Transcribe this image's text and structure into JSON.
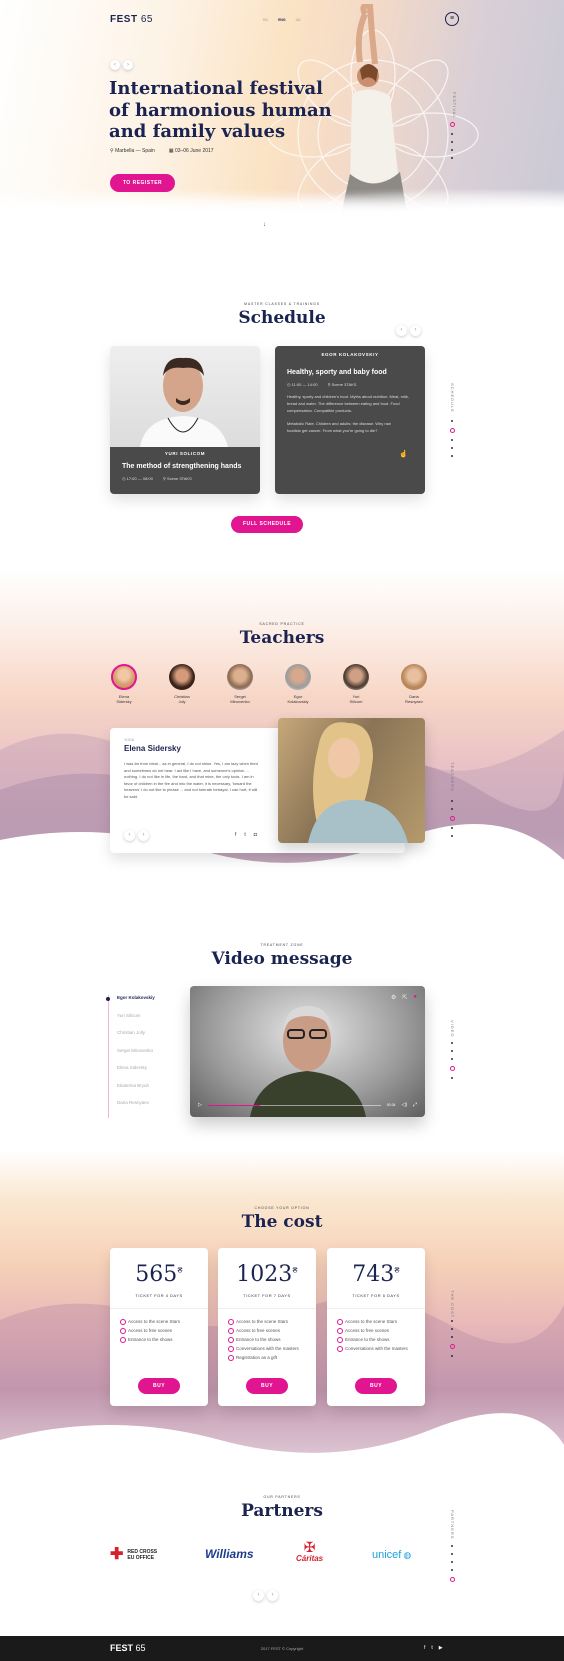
{
  "brand": {
    "name": "FEST",
    "num": "65"
  },
  "lang": [
    "RU",
    "ENG",
    "UA"
  ],
  "hero": {
    "title": [
      "International festival",
      "of harmonious human",
      "and family values"
    ],
    "location": "Marbella — Spain",
    "dates": "03–06 June 2017",
    "cta": "TO REGISTER",
    "side": "FESTIVAL"
  },
  "schedule": {
    "kicker": "MASTER CLASSES & TRAININGS",
    "title": "Schedule",
    "side": "SCHEDULE",
    "cta": "FULL SCHEDULE",
    "cards": [
      {
        "name": "YURI SOLICOM",
        "title": "The method of strengthening hands",
        "time": "17:00 — 08:00",
        "place": "Scene 3TAKS"
      },
      {
        "name": "EGOR KOLAKOVSKIY",
        "title": "Healthy, sporty and baby food",
        "time": "11:00 — 14:00",
        "place": "Scene 3TAKS",
        "text": "Healthy, sporty and children's food. Myths about nutrition. Meat, milk, bread and water. The difference between eating and food. Food compensation. Compatible products.",
        "text2": "Metabolic Rate. Children and adults: the disease. Why raw foodists get cancer. From what you're going to die?"
      }
    ]
  },
  "teachers": {
    "kicker": "SACRED PRACTICE",
    "title": "Teachers",
    "side": "TEACHERS",
    "list": [
      {
        "first": "Elena",
        "last": "Sidersky"
      },
      {
        "first": "Christian",
        "last": "Joly"
      },
      {
        "first": "Sergei",
        "last": "Minovenko"
      },
      {
        "first": "Egor",
        "last": "Kolakovskiy"
      },
      {
        "first": "Yuri",
        "last": "Silicom"
      },
      {
        "first": "Daria",
        "last": "Resnyaev"
      }
    ],
    "detail": {
      "small": "YOGA",
      "name": "Elena Sidersky",
      "text": "I was far from ideal... as in general, I do not shine. Yes, I am lazy when tired and sometimes do not hear. I act like I have, and someone's opinion ... nothing. I do not like in life, the hard, and that mine, the only tools. I am in favor of children in the fire and into the water, it is necessary, 'toward the heavens' I do not like to please ... and not tolerate betrayal. I can hurt, it will be said."
    }
  },
  "video": {
    "kicker": "TREATMENT ZONE",
    "title": "Video message",
    "side": "VIDEO",
    "time": "00:34",
    "list": [
      "Egor Kolakovskiy",
      "Yuri Silicom",
      "Christian Jolly",
      "Sergei Minovenko",
      "Elena Sidersky",
      "Ekaterina Bryuh",
      "Daria Resnyaev"
    ]
  },
  "cost": {
    "kicker": "CHOOSE YOUR OPTION",
    "title": "The cost",
    "side": "THE COST",
    "plans": [
      {
        "price": "565",
        "cur": "₴",
        "label": "TICKET FOR 4 DAYS",
        "items": [
          "Access to the scene Stars",
          "Access to free scenes",
          "Entrance to the shows"
        ],
        "buy": "BUY"
      },
      {
        "price": "1023",
        "cur": "₴",
        "label": "TICKET FOR 7 DAYS",
        "items": [
          "Access to the scene Stars",
          "Access to free scenes",
          "Entrance to the shows",
          "Conversations with the masters",
          "Registration as a gift"
        ],
        "buy": "BUY"
      },
      {
        "price": "743",
        "cur": "₴",
        "label": "TICKET FOR 5 DAYS",
        "items": [
          "Access to the scene Stars",
          "Access to free scenes",
          "Entrance to the shows",
          "Conversations with the masters"
        ],
        "buy": "BUY"
      }
    ]
  },
  "partners": {
    "kicker": "OUR PARTNERS",
    "title": "Partners",
    "side": "PARTNERS",
    "list": [
      "RED CROSS",
      "EU OFFICE",
      "Williams",
      "Cáritas",
      "unicef"
    ]
  },
  "footer": {
    "brand": "FEST",
    "num": "65",
    "copy": "2017 FEST © Copyright"
  }
}
